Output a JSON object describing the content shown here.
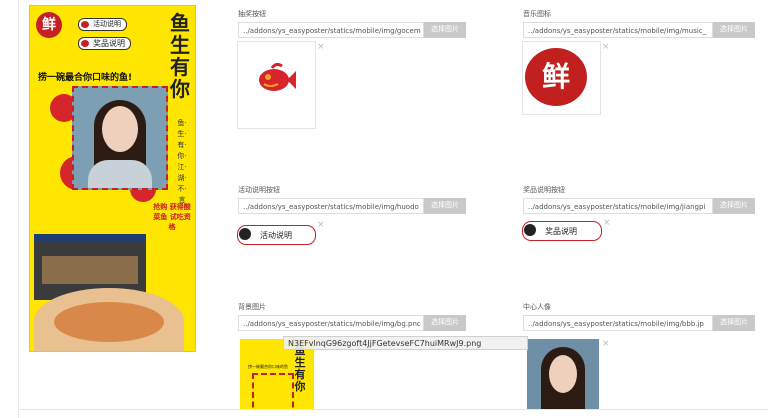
{
  "poster": {
    "logo_char": "鲜",
    "pill_activity": "活动说明",
    "pill_prize": "奖品说明",
    "title_chars": [
      "鱼",
      "生",
      "有",
      "你"
    ],
    "slogan": "捞一碗最合你口味的鱼!",
    "vertical_text": "鱼·生·有·你·江·湖·不·言",
    "sub_text": "抢购 获得酸菜鱼 试吃资格"
  },
  "fields": [
    {
      "label": "抽奖按钮",
      "value": "../addons/ys_easyposter/statics/mobile/img/gocem",
      "button": "选择图片"
    },
    {
      "label": "音乐图标",
      "value": "../addons/ys_easyposter/statics/mobile/img/music_",
      "button": "选择图片"
    },
    {
      "label": "活动说明按钮",
      "value": "../addons/ys_easyposter/statics/mobile/img/huodo",
      "button": "选择图片"
    },
    {
      "label": "奖品说明按钮",
      "value": "../addons/ys_easyposter/statics/mobile/img/jiangpi",
      "button": "选择图片"
    },
    {
      "label": "背景图片",
      "value": "../addons/ys_easyposter/statics/mobile/img/bg.pnc",
      "button": "选择图片"
    },
    {
      "label": "中心人像",
      "value": "../addons/ys_easyposter/statics/mobile/img/bbb.jp",
      "button": "选择图片"
    }
  ],
  "thumbs": {
    "music_char": "鲜",
    "activity_label": "活动说明",
    "prize_label": "奖品说明",
    "bg_title": "鱼生有你",
    "bg_slogan": "捞一碗最合你口味的鱼"
  },
  "close_glyph": "×",
  "tooltip": "N3EFvlnqG96zgoft4JjFGetevseFC7huiMRwJ9.png",
  "colors": {
    "accent_red": "#c62026",
    "poster_yellow": "#ffe600",
    "button_grey": "#c9c9c9"
  }
}
